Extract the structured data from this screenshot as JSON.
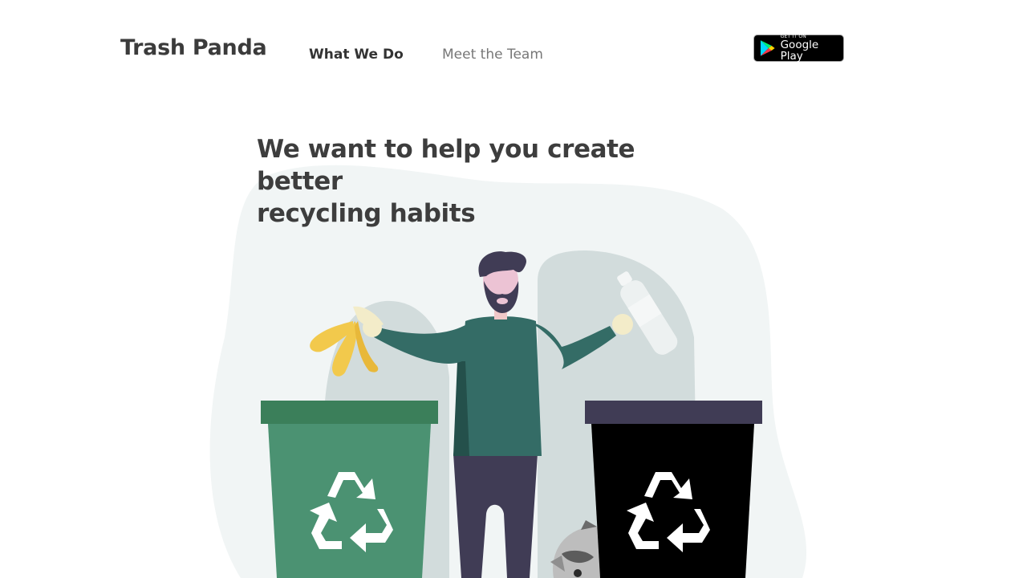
{
  "header": {
    "brand": "Trash Panda",
    "nav": [
      {
        "label": "What We Do",
        "active": true
      },
      {
        "label": "Meet the Team",
        "active": false
      }
    ],
    "store_badge": {
      "small": "GET IT ON",
      "big": "Google Play"
    }
  },
  "hero": {
    "title_line1": "We want to help you create better",
    "title_line2": "recycling habits"
  },
  "colors": {
    "blob": "#f1f5f5",
    "back_shape": "#d2dcdc",
    "shirt": "#346c66",
    "pants": "#403c55",
    "green_bin": "#4b9272",
    "green_lid": "#3b7f5a",
    "black_bin": "#000000",
    "black_lid": "#403c55",
    "banana": "#f2c94c"
  },
  "icons": [
    "recycle-icon",
    "google-play-icon",
    "banana-peel-icon",
    "bottle-icon",
    "raccoon-icon"
  ]
}
